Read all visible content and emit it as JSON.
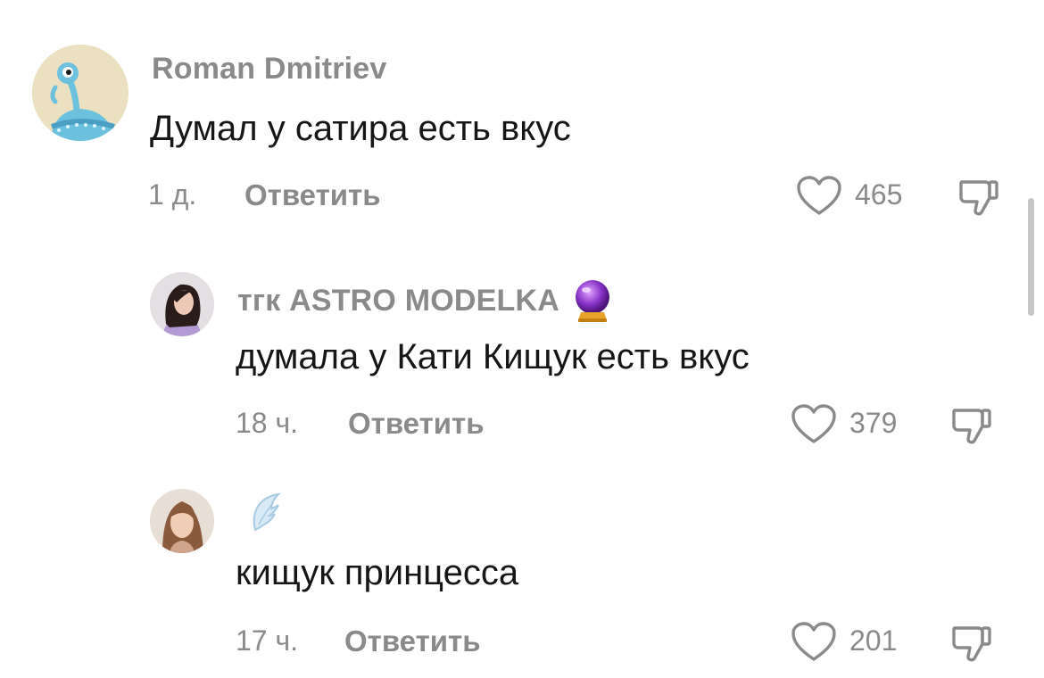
{
  "comments": [
    {
      "username": "Roman Dmitriev",
      "text": "Думал у сатира есть вкус",
      "time": "1 д.",
      "reply_label": "Ответить",
      "likes": "465",
      "avatar": "alien-avatar-icon"
    },
    {
      "username": "тгк ASTRO MODELKA",
      "username_emoji": "crystal-ball-icon",
      "text": "думала у Кати Кищук есть вкус",
      "time": "18 ч.",
      "reply_label": "Ответить",
      "likes": "379",
      "avatar": "girl-photo-avatar"
    },
    {
      "username": "",
      "username_emoji": "wing-icon",
      "text": "кищук принцесса",
      "time": "17 ч.",
      "reply_label": "Ответить",
      "likes": "201",
      "avatar": "girl-photo-avatar-2"
    }
  ],
  "colors": {
    "text": "#161616",
    "secondary": "#8a8a8a",
    "background": "#ffffff"
  }
}
